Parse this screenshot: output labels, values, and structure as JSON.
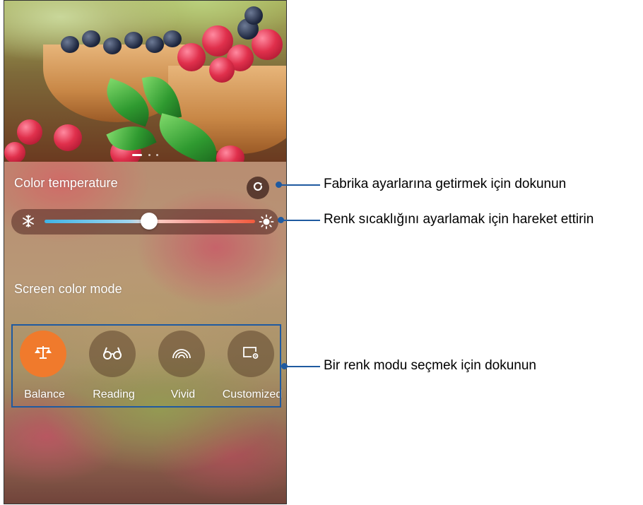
{
  "settings": {
    "color_temperature_label": "Color temperature",
    "screen_color_mode_label": "Screen color mode",
    "reset_icon": "refresh-icon",
    "slider": {
      "cold_icon": "snowflake-icon",
      "warm_icon": "sun-icon",
      "value_fraction": 0.5
    },
    "modes": [
      {
        "label": "Balance",
        "icon": "scale-icon",
        "selected": true
      },
      {
        "label": "Reading",
        "icon": "glasses-icon",
        "selected": false
      },
      {
        "label": "Vivid",
        "icon": "rainbow-icon",
        "selected": false
      },
      {
        "label": "Customized",
        "icon": "custom-screen-icon",
        "selected": false
      }
    ],
    "pager": {
      "pages": 3,
      "active": 0
    }
  },
  "callouts": {
    "reset": "Fabrika ayarlarına getirmek için dokunun",
    "slider": "Renk sıcaklığını ayarlamak için hareket ettirin",
    "mode": "Bir renk modu seçmek için dokunun"
  },
  "colors": {
    "accent_selected": "#f07a2c",
    "callout_blue": "#1f5aa0"
  }
}
